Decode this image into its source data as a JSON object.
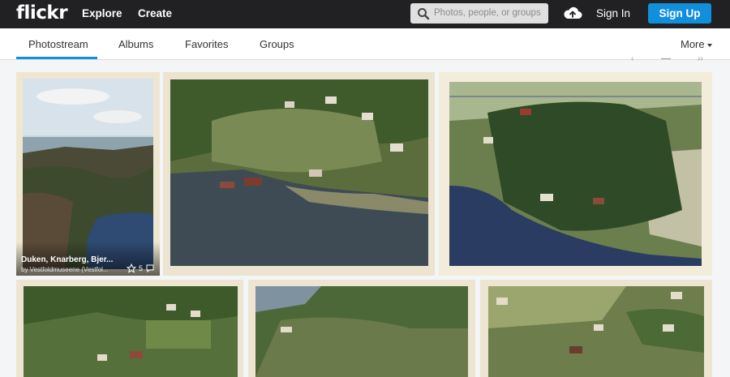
{
  "header": {
    "logo": "flickr",
    "nav": [
      {
        "label": "Explore"
      },
      {
        "label": "Create"
      }
    ],
    "search_placeholder": "Photos, people, or groups",
    "sign_in": "Sign In",
    "sign_up": "Sign Up"
  },
  "subnav": {
    "tabs": [
      {
        "label": "Photostream",
        "active": true
      },
      {
        "label": "Albums"
      },
      {
        "label": "Favorites"
      },
      {
        "label": "Groups"
      }
    ],
    "more": "More"
  },
  "photos": [
    {
      "title": "Duken, Knarberg, Bjer...",
      "author": "by Vestfoldmuseene (Vestfol...",
      "faves": "5"
    }
  ],
  "colors": {
    "topbar": "#212124",
    "accent": "#128fdc",
    "page_bg": "#f3f5f6"
  }
}
